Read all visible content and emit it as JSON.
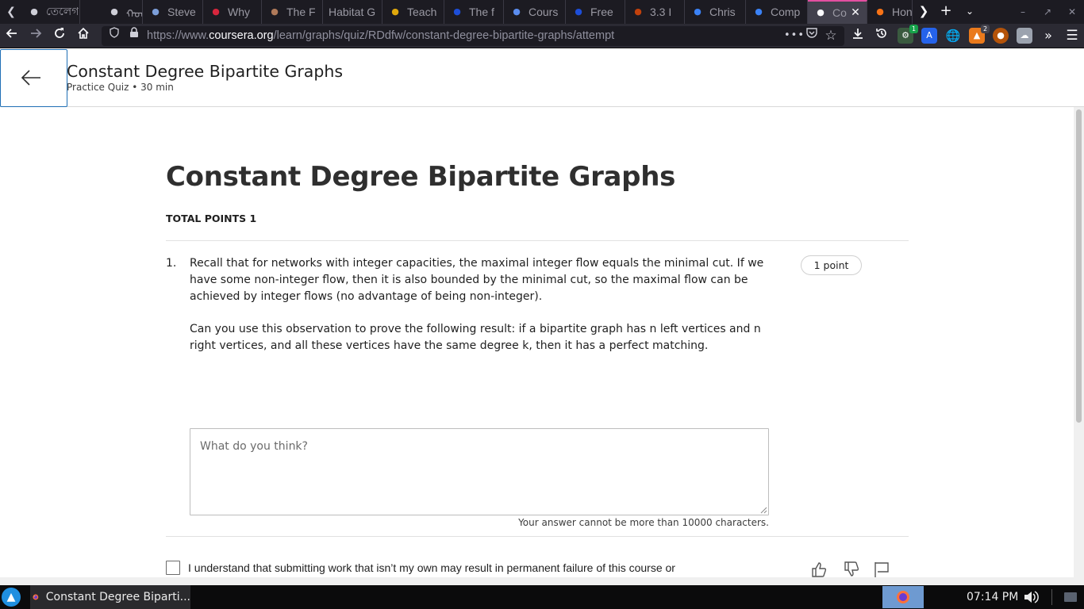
{
  "browser": {
    "tabs": [
      {
        "title": "তেলেগ",
        "favicon": "ring-icon",
        "color": "#cfcfd8"
      },
      {
        "title": "ᠬᠣᠩ",
        "favicon": "script-icon",
        "color": "#cfcfd8"
      },
      {
        "title": "Steve",
        "favicon": "image-icon",
        "color": "#7c9ed9"
      },
      {
        "title": "Why",
        "favicon": "s-logo-icon",
        "color": "#d7263d"
      },
      {
        "title": "The F",
        "favicon": "avatar-icon",
        "color": "#b07a5a"
      },
      {
        "title": "Habitat G",
        "favicon": "",
        "color": ""
      },
      {
        "title": "Teach",
        "favicon": "key-icon",
        "color": "#e0a80c"
      },
      {
        "title": "The f",
        "favicon": "c-logo-icon",
        "color": "#1d4ed8"
      },
      {
        "title": "Cours",
        "favicon": "infinity-icon",
        "color": "#5b8def"
      },
      {
        "title": "Free",
        "favicon": "c-logo-icon",
        "color": "#1d4ed8"
      },
      {
        "title": "3.3 I",
        "favicon": "hp-logo-icon",
        "color": "#c2410c"
      },
      {
        "title": "Chris",
        "favicon": "graduation-cap-icon",
        "color": "#3b82f6"
      },
      {
        "title": "Comp",
        "favicon": "u-logo-icon",
        "color": "#3b82f6"
      },
      {
        "title": "Co",
        "favicon": "infinity-icon",
        "color": "#fbfbfe",
        "active": true
      },
      {
        "title": "Hon",
        "favicon": "swoosh-icon",
        "color": "#f97316"
      }
    ],
    "url_prefix": "https://www.",
    "url_host": "coursera.org",
    "url_path": "/learn/graphs/quiz/RDdfw/constant-degree-bipartite-graphs/attempt",
    "ext_badge_green": "1",
    "ext_badge_orange": "2"
  },
  "header": {
    "title": "Constant Degree Bipartite Graphs",
    "subtitle": "Practice Quiz • 30 min"
  },
  "quiz": {
    "title": "Constant Degree Bipartite Graphs",
    "total_points": "TOTAL POINTS 1",
    "question": {
      "number": "1.",
      "paragraph1": "Recall that for networks with integer capacities, the maximal integer flow equals the minimal cut. If we have some non-integer flow, then it is also bounded by the minimal cut, so the maximal flow can be achieved by integer flows (no advantage of being non-integer).",
      "paragraph2": "Can you use this observation to prove the following result: if a bipartite graph has n left vertices and n right vertices, and all these vertices have the same degree k, then it has a perfect matching.",
      "points": "1 point",
      "answer_placeholder": "What do you think?",
      "answer_value": "",
      "char_limit_note": "Your answer cannot be more than 10000 characters."
    },
    "honor_code": "I understand that submitting work that isn’t my own may result in permanent failure of this course or"
  },
  "taskbar": {
    "window_title": "Constant Degree Biparti...",
    "clock": "07:14 PM"
  },
  "colors": {
    "accent": "#1f6fb5",
    "active_tab_line": "#e24fa1"
  }
}
